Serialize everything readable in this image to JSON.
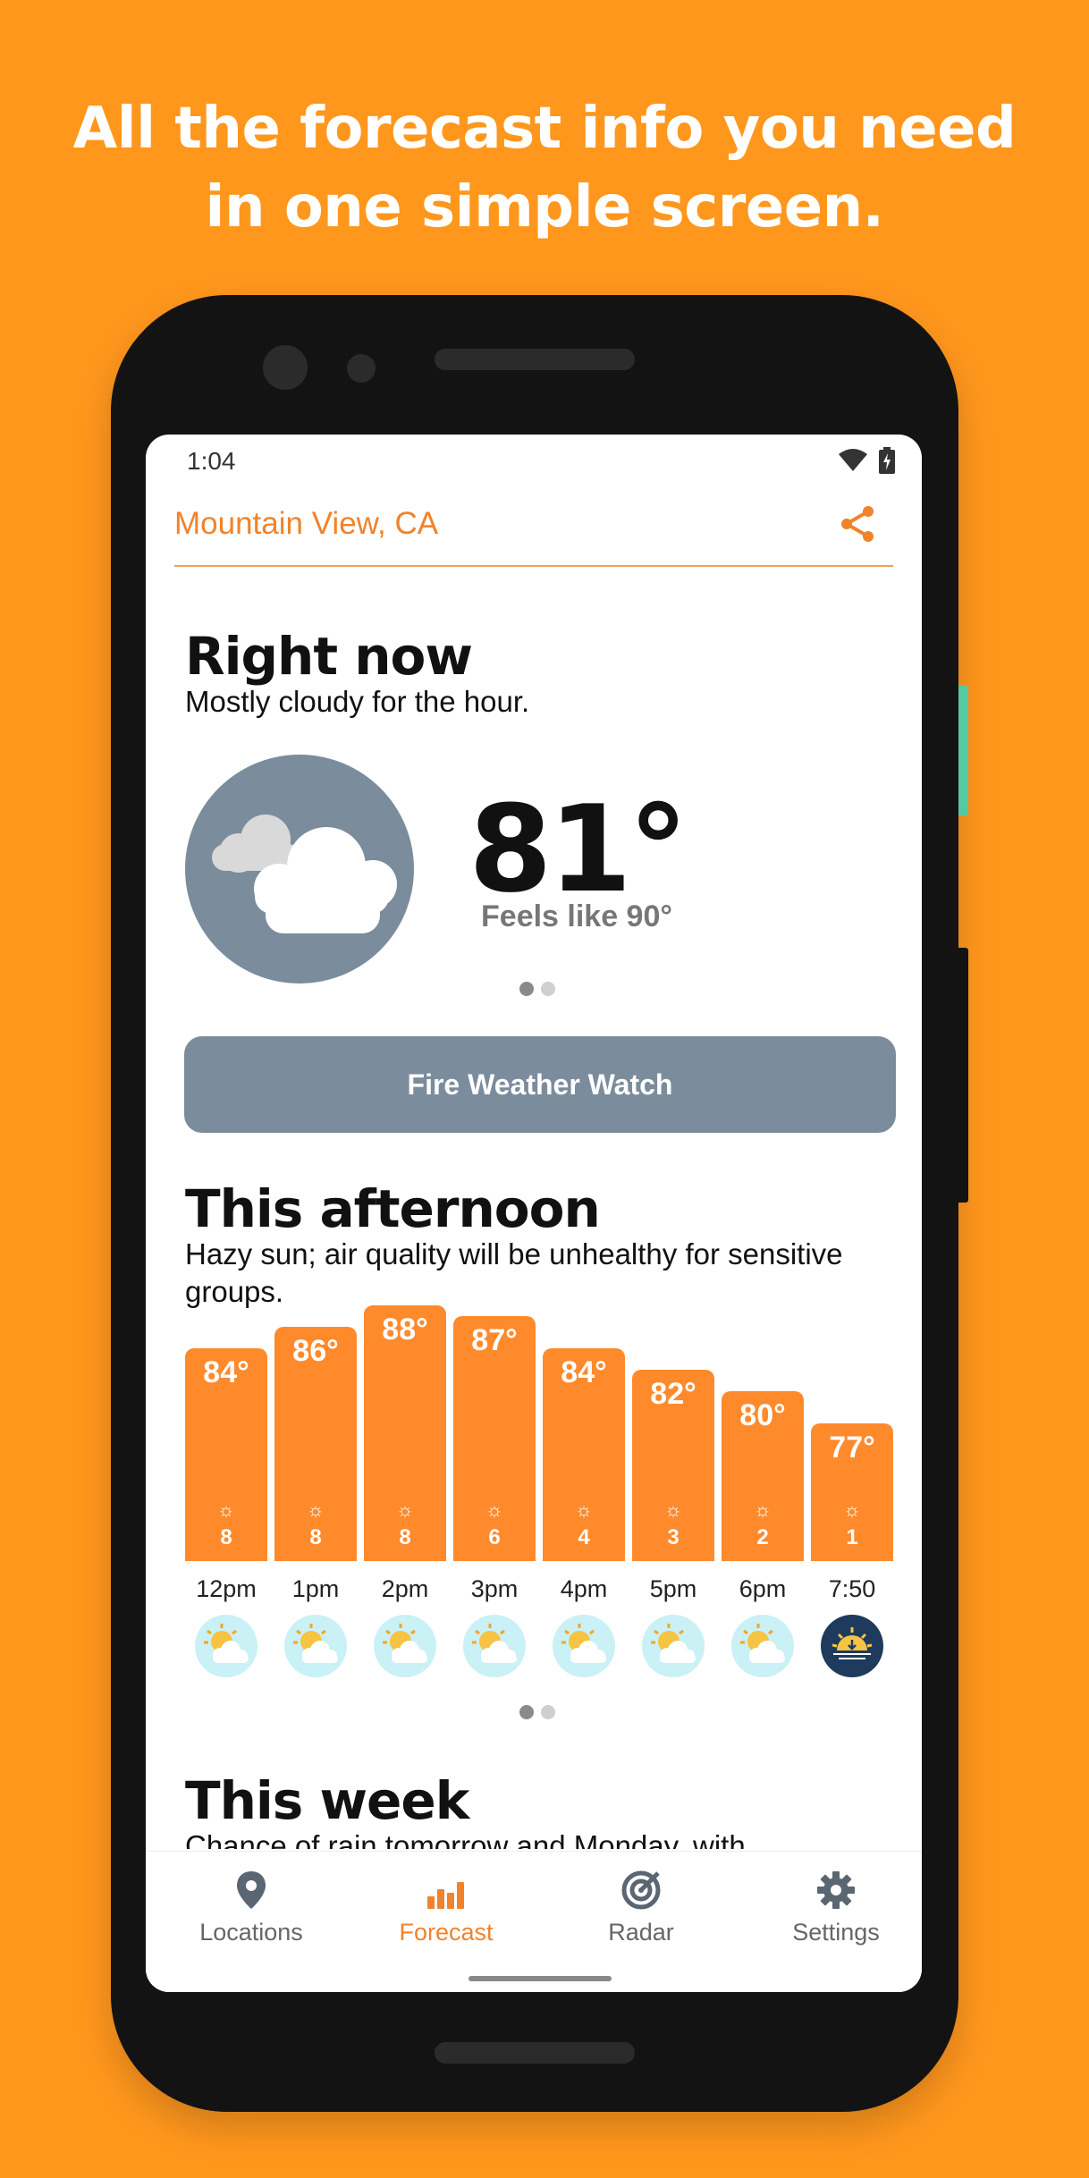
{
  "headline": {
    "line1": "All the forecast info you need",
    "line2": "in one simple screen."
  },
  "status_bar": {
    "time": "1:04"
  },
  "appbar": {
    "location": "Mountain View, CA",
    "share_icon": "share-icon"
  },
  "right_now": {
    "title": "Right now",
    "summary": "Mostly cloudy for the hour.",
    "temperature": "81°",
    "feels_like": "Feels like 90°",
    "condition_icon": "cloudy-icon",
    "pager": {
      "pages": 2,
      "active": 0
    }
  },
  "alert": {
    "label": "Fire Weather Watch"
  },
  "this_afternoon": {
    "title": "This afternoon",
    "summary": "Hazy sun; air quality will be unhealthy for sensitive groups.",
    "hours": [
      {
        "time": "12pm",
        "temp": "84°",
        "sun": "☼",
        "uv": "8",
        "temp_value": 84,
        "icon": "hazy-sun-icon"
      },
      {
        "time": "1pm",
        "temp": "86°",
        "sun": "☼",
        "uv": "8",
        "temp_value": 86,
        "icon": "hazy-sun-icon"
      },
      {
        "time": "2pm",
        "temp": "88°",
        "sun": "☼",
        "uv": "8",
        "temp_value": 88,
        "icon": "hazy-sun-icon"
      },
      {
        "time": "3pm",
        "temp": "87°",
        "sun": "☼",
        "uv": "6",
        "temp_value": 87,
        "icon": "hazy-sun-icon"
      },
      {
        "time": "4pm",
        "temp": "84°",
        "sun": "☼",
        "uv": "4",
        "temp_value": 84,
        "icon": "hazy-sun-icon"
      },
      {
        "time": "5pm",
        "temp": "82°",
        "sun": "☼",
        "uv": "3",
        "temp_value": 82,
        "icon": "hazy-sun-icon"
      },
      {
        "time": "6pm",
        "temp": "80°",
        "sun": "☼",
        "uv": "2",
        "temp_value": 80,
        "icon": "hazy-sun-icon"
      },
      {
        "time": "7:50",
        "temp": "77°",
        "sun": "☼",
        "uv": "1",
        "temp_value": 77,
        "icon": "sunset-icon"
      }
    ],
    "pager": {
      "pages": 2,
      "active": 0
    }
  },
  "this_week": {
    "title": "This week",
    "summary": "Chance of rain tomorrow and Monday, with"
  },
  "bottom_nav": [
    {
      "label": "Locations",
      "icon": "location-pin-icon",
      "active": false
    },
    {
      "label": "Forecast",
      "icon": "bar-chart-icon",
      "active": true
    },
    {
      "label": "Radar",
      "icon": "radar-icon",
      "active": false
    },
    {
      "label": "Settings",
      "icon": "gear-icon",
      "active": false
    }
  ],
  "colors": {
    "background": "#FF971D",
    "accent": "#F0832B",
    "bar": "#FF8A2C",
    "slate": "#7B8C9C"
  }
}
